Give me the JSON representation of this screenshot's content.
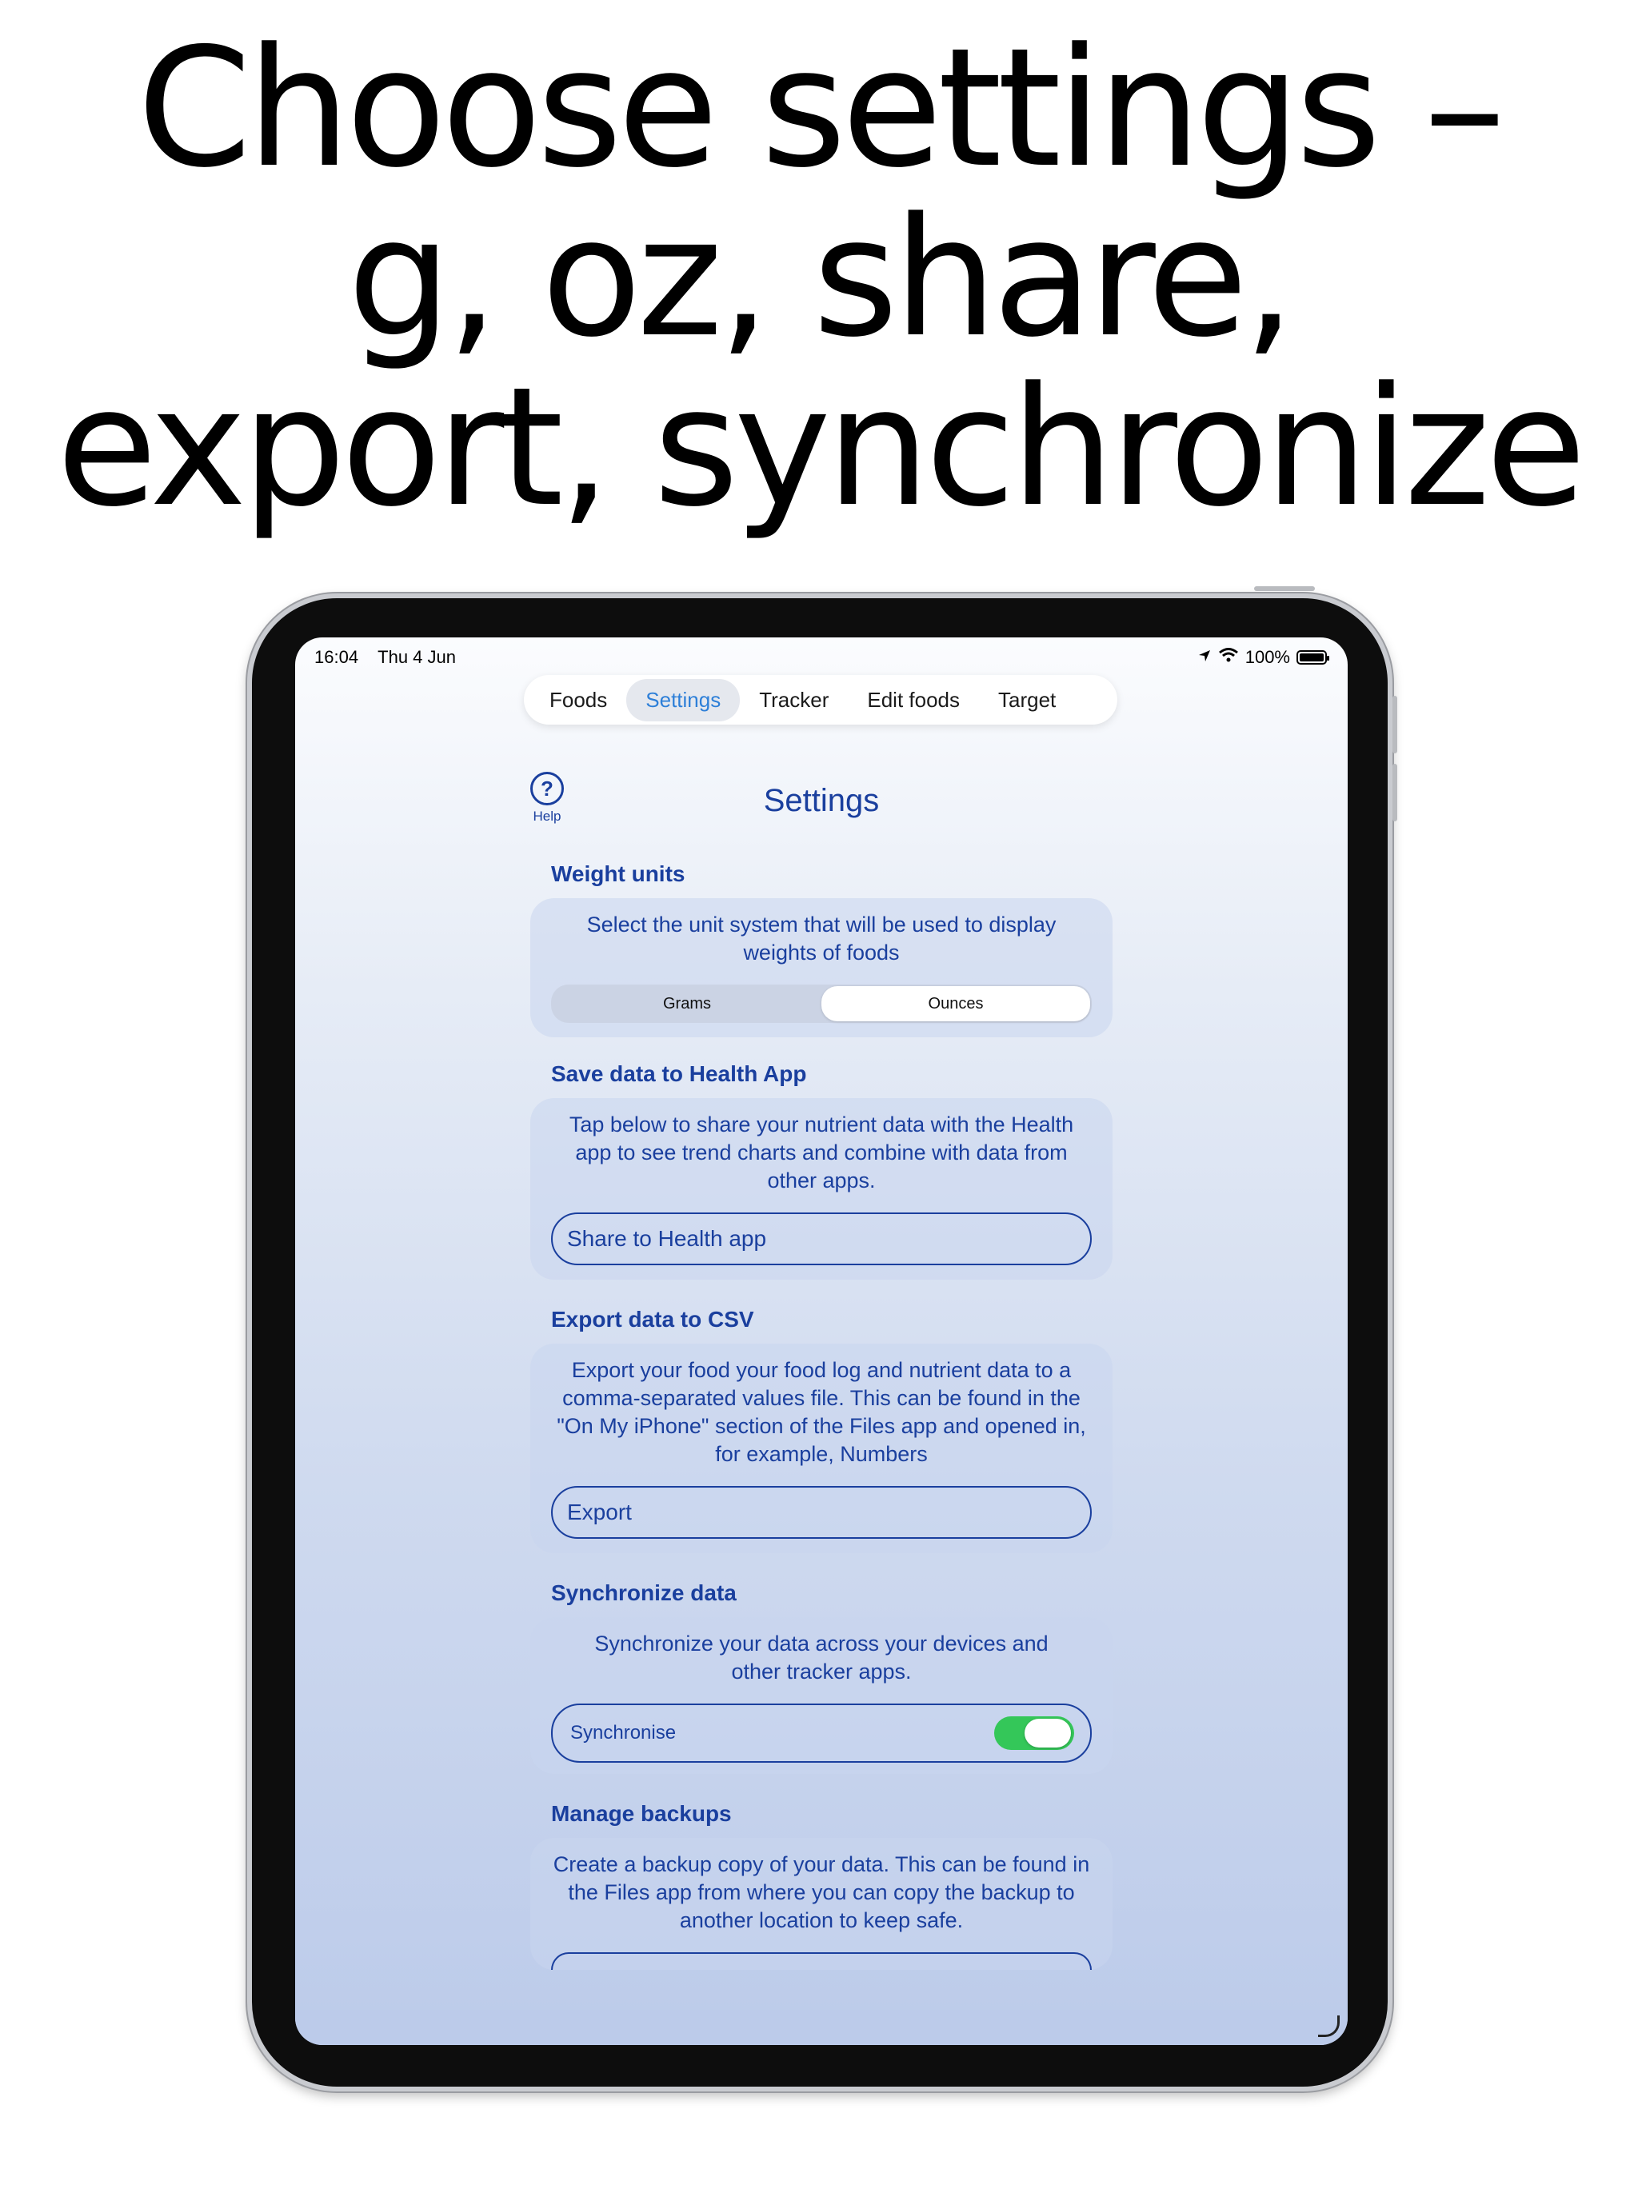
{
  "headline": {
    "line1": "Choose settings –",
    "line2": "g, oz, share,",
    "line3": "export, synchronize"
  },
  "status_bar": {
    "time": "16:04",
    "date": "Thu 4 Jun",
    "battery": "100%"
  },
  "tabs": [
    {
      "label": "Foods"
    },
    {
      "label": "Settings"
    },
    {
      "label": "Tracker"
    },
    {
      "label": "Edit foods"
    },
    {
      "label": "Target"
    }
  ],
  "active_tab": "Settings",
  "help": {
    "icon": "?",
    "label": "Help"
  },
  "page_title": "Settings",
  "sections": {
    "weight_units": {
      "heading": "Weight units",
      "description": "Select the unit system that will be used to display weights of foods",
      "options": [
        "Grams",
        "Ounces"
      ],
      "selected": "Ounces"
    },
    "health": {
      "heading": "Save data to Health App",
      "description": "Tap below to share your nutrient data with the Health app to see trend charts and combine with data from other apps.",
      "button": "Share to Health app"
    },
    "export": {
      "heading": "Export data to CSV",
      "description": "Export your food your food log and nutrient data to a comma-separated values file. This can be found in the \"On My iPhone\" section of the Files app and opened in, for example, Numbers",
      "button": "Export"
    },
    "sync": {
      "heading": "Synchronize data",
      "description": "Synchronize your data across your devices and other tracker apps.",
      "toggle_label": "Synchronise",
      "toggle_on": true
    },
    "backups": {
      "heading": "Manage backups",
      "description": "Create a backup copy of your data. This can be found in the Files app from where you can copy the backup to another location to keep safe."
    }
  },
  "colors": {
    "accent": "#1a3f9e",
    "tab_active": "#2d7fd8",
    "switch_on": "#34c759"
  }
}
